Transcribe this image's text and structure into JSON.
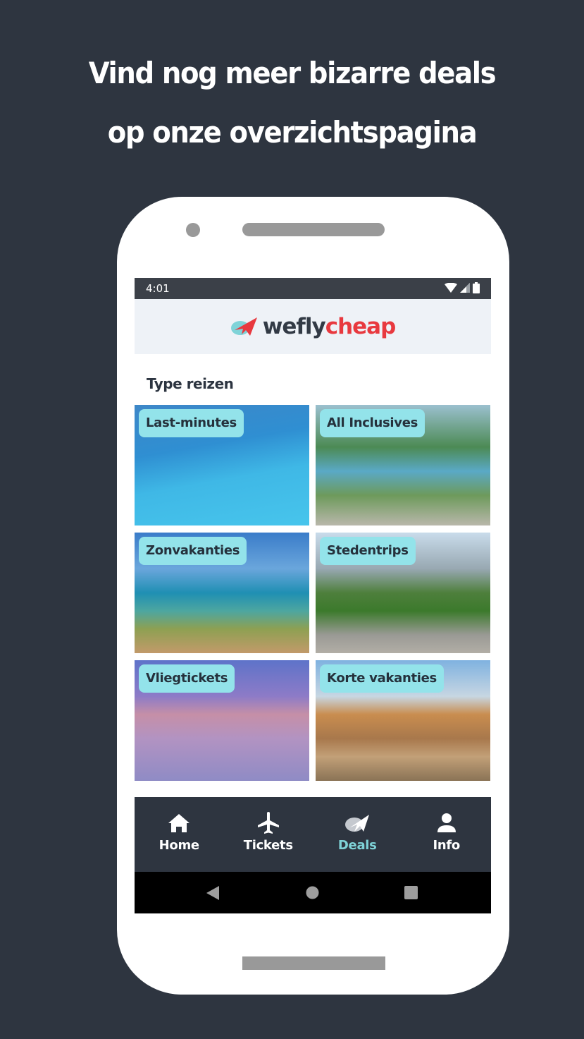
{
  "headline": {
    "line1": "Vind nog meer bizarre deals",
    "line2": "op onze overzichtspagina"
  },
  "statusbar": {
    "time": "4:01",
    "icons": [
      "wifi-icon",
      "signal-icon",
      "battery-icon"
    ]
  },
  "app": {
    "logo": {
      "part1": "wefly",
      "part2": "cheap",
      "color_dark": "#323a45",
      "color_accent": "#e8393f",
      "color_teal": "#7fd3d8"
    },
    "section_title": "Type reizen",
    "tiles": [
      {
        "label": "Last-minutes",
        "image": "beach-cliff-photo"
      },
      {
        "label": "All Inclusives",
        "image": "resort-pool-photo"
      },
      {
        "label": "Zonvakanties",
        "image": "coastal-village-photo"
      },
      {
        "label": "Stedentrips",
        "image": "city-park-aerial-photo"
      },
      {
        "label": "Vliegtickets",
        "image": "airplane-wing-sunset-photo"
      },
      {
        "label": "Korte vakanties",
        "image": "colosseum-photo"
      }
    ],
    "label_bg": "#93e3ea"
  },
  "bottom_nav": {
    "items": [
      {
        "label": "Home",
        "icon": "home-icon",
        "active": false
      },
      {
        "label": "Tickets",
        "icon": "airplane-icon",
        "active": false
      },
      {
        "label": "Deals",
        "icon": "deals-logo-icon",
        "active": true
      },
      {
        "label": "Info",
        "icon": "person-icon",
        "active": false
      }
    ],
    "active_color": "#7fd3d8"
  },
  "system_nav": [
    "back-icon",
    "home-circle-icon",
    "recents-icon"
  ]
}
